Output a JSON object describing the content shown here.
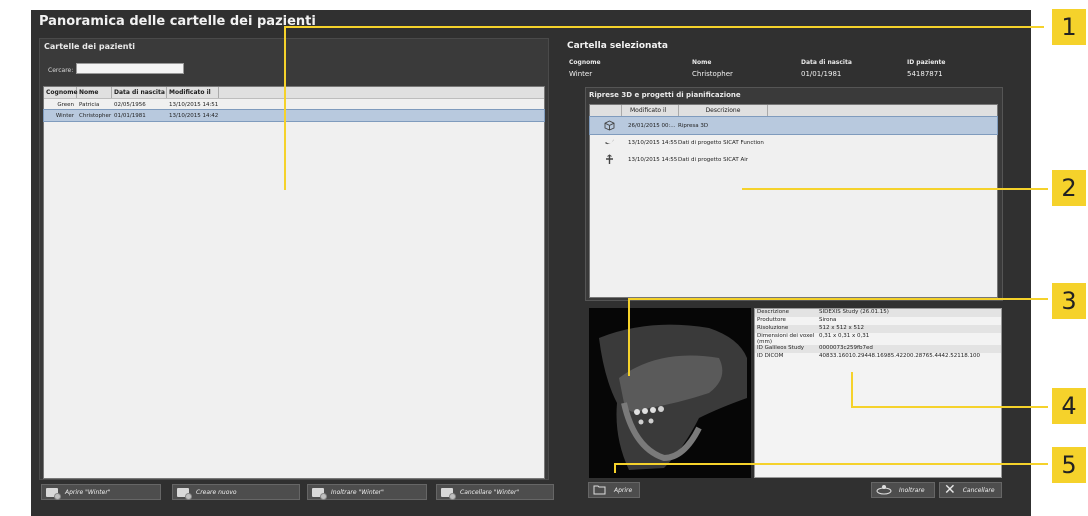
{
  "window": {
    "title": "Panoramica delle cartelle dei pazienti"
  },
  "patients": {
    "heading": "Cartelle dei pazienti",
    "search_label": "Cercare:",
    "search_value": "",
    "columns": [
      "Cognome",
      "Nome",
      "Data di nascita",
      "Modificato il"
    ],
    "rows": [
      {
        "surname": "Green",
        "name": "Patricia",
        "dob": "02/05/1956",
        "modified": "13/10/2015 14:51",
        "selected": false
      },
      {
        "surname": "Winter",
        "name": "Christopher",
        "dob": "01/01/1981",
        "modified": "13/10/2015 14:42",
        "selected": true
      }
    ],
    "buttons": {
      "open": "Aprire \"Winter\"",
      "create": "Creare nuovo",
      "forward": "Inoltrare \"Winter\"",
      "delete": "Cancellare \"Winter\""
    }
  },
  "selected": {
    "heading": "Cartella selezionata",
    "labels": {
      "surname": "Cognome",
      "name": "Nome",
      "dob": "Data di nascita",
      "id": "ID paziente"
    },
    "values": {
      "surname": "Winter",
      "name": "Christopher",
      "dob": "01/01/1981",
      "id": "54187871"
    }
  },
  "scans": {
    "heading": "Riprese 3D e progetti di pianificazione",
    "columns": [
      "Modificato il",
      "Descrizione"
    ],
    "rows": [
      {
        "icon": "cube-icon",
        "date": "26/01/2015 00:...",
        "desc": "Ripresa 3D",
        "selected": true
      },
      {
        "icon": "jaw-motion-icon",
        "date": "13/10/2015 14:55",
        "desc": "Dati di progetto SICAT Function",
        "selected": false
      },
      {
        "icon": "airway-icon",
        "date": "13/10/2015 14:55",
        "desc": "Dati di progetto SICAT Air",
        "selected": false
      }
    ]
  },
  "details": [
    {
      "key": "Descrizione",
      "value": "SIDEXIS Study (26.01.15)"
    },
    {
      "key": "Produttore",
      "value": "Sirona"
    },
    {
      "key": "Risoluzione",
      "value": "512 x 512 x 512"
    },
    {
      "key": "Dimensioni dei voxel (mm)",
      "value": "0,31 x 0,31 x 0,31"
    },
    {
      "key": "ID Galileos Study",
      "value": "0000073c259fb7ed"
    },
    {
      "key": "ID DICOM",
      "value": "40833.16010.29448.16985.42200.28765.4442.52118.100"
    }
  ],
  "actions": {
    "open": "Aprire",
    "forward": "Inoltrare",
    "delete": "Cancellare"
  },
  "callouts": [
    "1",
    "2",
    "3",
    "4",
    "5"
  ],
  "colors": {
    "callout": "#f5d22b",
    "selection": "#b8c9de",
    "background": "#303030"
  }
}
